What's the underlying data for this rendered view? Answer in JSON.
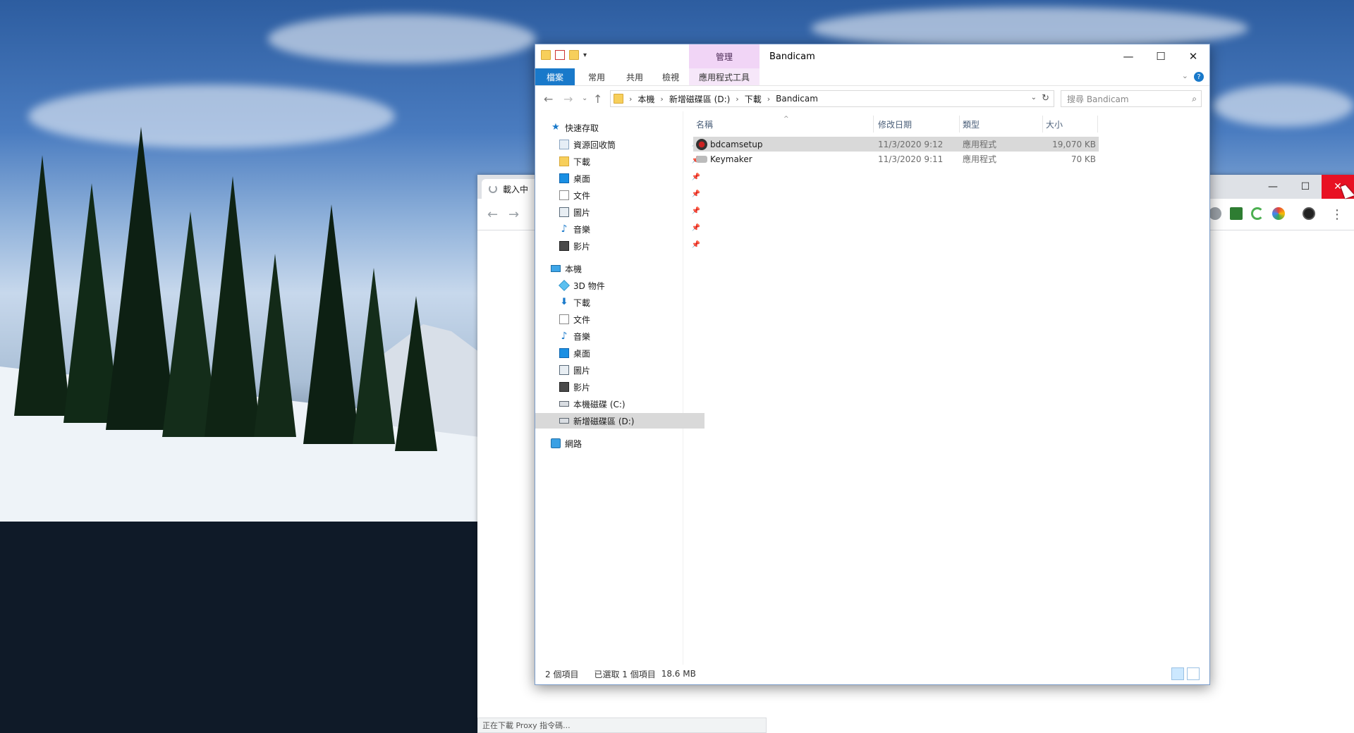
{
  "explorer": {
    "title": "Bandicam",
    "context_tab": "管理",
    "ribbon_tabs": [
      "檔案",
      "常用",
      "共用",
      "檢視",
      "應用程式工具"
    ],
    "address": [
      "本機",
      "新增磁碟區 (D:)",
      "下載",
      "Bandicam"
    ],
    "search_placeholder": "搜尋 Bandicam",
    "nav": {
      "quick_access": "快速存取",
      "quick_items": [
        "資源回收筒",
        "下載",
        "桌面",
        "文件",
        "圖片",
        "音樂",
        "影片"
      ],
      "this_pc": "本機",
      "pc_items": [
        "3D 物件",
        "下載",
        "文件",
        "音樂",
        "桌面",
        "圖片",
        "影片",
        "本機磁碟 (C:)",
        "新增磁碟區 (D:)"
      ],
      "network": "網路"
    },
    "columns": [
      "名稱",
      "修改日期",
      "類型",
      "大小"
    ],
    "files": [
      {
        "name": "bdcamsetup",
        "date": "11/3/2020 9:12",
        "type": "應用程式",
        "size": "19,070 KB"
      },
      {
        "name": "Keymaker",
        "date": "11/3/2020 9:11",
        "type": "應用程式",
        "size": "70 KB"
      }
    ],
    "status": {
      "count": "2 個項目",
      "selected": "已選取 1 個項目",
      "size": "18.6 MB"
    }
  },
  "chrome": {
    "tab_title": "載入中",
    "status_text": "正在下載 Proxy 指令碼..."
  },
  "colors": {
    "file_tab": "#1979ca",
    "context_tab": "#f1d5f6",
    "close_red": "#e81123",
    "selection": "#d9d9d9"
  }
}
